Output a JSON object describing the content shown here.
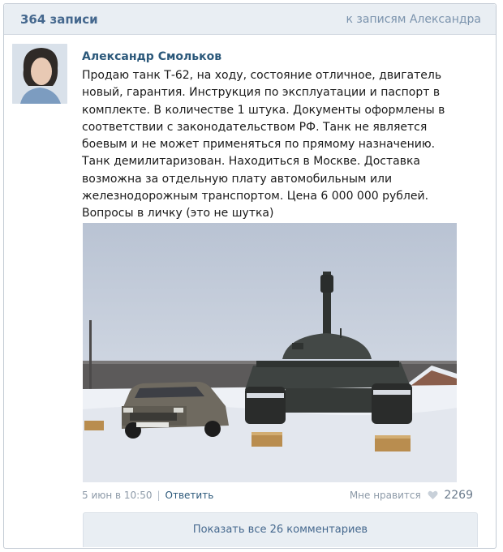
{
  "header": {
    "count_label": "364 записи",
    "back_link": "к записям Александра"
  },
  "post": {
    "author": "Александр Смольков",
    "text_lines": [
      "Продаю танк Т-62, на ходу, состояние отличное, двигатель",
      "новый, гарантия. Инструкция по эксплуатации и паспорт в",
      "комплекте. В количестве 1 штука. Документы оформлены в",
      "соответствии с законодательством РФ. Танк не является",
      "боевым и не может применяться по прямому назначению.",
      "Танк демилитаризован. Находиться в Москве. Доставка",
      "возможна за отдельную плату автомобильным или",
      "железнодорожным транспортом. Цена 6 000 000 рублей.",
      "Вопросы в личку (это не шутка)"
    ],
    "date": "5 июн в 10:50",
    "reply_label": "Ответить",
    "like_label": "Мне нравится",
    "like_count": "2269"
  },
  "comments": {
    "show_all_label": "Показать все 26 комментариев"
  },
  "icons": {
    "heart": "heart-icon"
  },
  "colors": {
    "link": "#2b587a",
    "header_bg": "#e9eef3",
    "muted": "#8d9aa8"
  }
}
